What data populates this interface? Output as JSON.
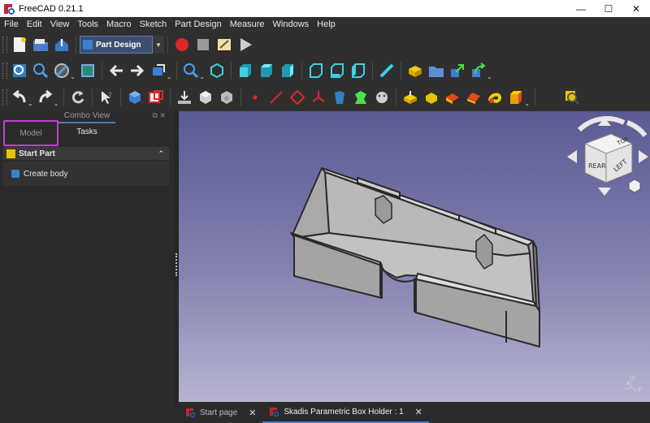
{
  "window": {
    "title": "FreeCAD 0.21.1",
    "minimize": "—",
    "maximize": "☐",
    "close": "✕"
  },
  "menu": [
    "File",
    "Edit",
    "View",
    "Tools",
    "Macro",
    "Sketch",
    "Part Design",
    "Measure",
    "Windows",
    "Help"
  ],
  "toolbar": {
    "workbench": "Part Design",
    "workbench_arrow": "▾"
  },
  "combo_view": {
    "title": "Combo View",
    "header_controls": "⧉ ✕",
    "tabs": [
      "Model",
      "Tasks"
    ],
    "panel_title": "Start Part",
    "panel_collapse": "⌃",
    "action": "Create body"
  },
  "navcube": {
    "top": "TOP",
    "rear": "REAR",
    "left": "LEFT"
  },
  "axis": {
    "z": "z",
    "y": "y",
    "x": "x"
  },
  "doc_tabs": [
    {
      "label": "Start page",
      "close": "✕"
    },
    {
      "label": "Skadis Parametric Box Holder : 1",
      "close": "✕"
    }
  ],
  "colors": {
    "accent": "#4a78c0",
    "highlight": "#c040d0",
    "viewport_top": "#5a5a94",
    "viewport_bottom": "#b7b5d1",
    "model_fill": "#c4c4c4"
  }
}
